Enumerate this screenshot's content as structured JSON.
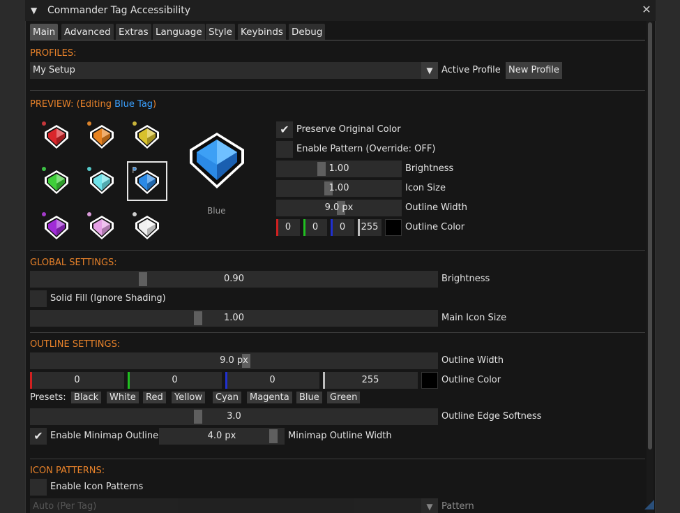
{
  "window": {
    "title": "Commander Tag Accessibility",
    "collapse_glyph": "▼",
    "close_glyph": "✕"
  },
  "tabs": [
    "Main",
    "Advanced",
    "Extras",
    "Language",
    "Style",
    "Keybinds",
    "Debug"
  ],
  "profiles": {
    "header": "PROFILES:",
    "selected": "My Setup",
    "active_label": "Active Profile",
    "new_button": "New Profile"
  },
  "preview": {
    "header_prefix": "PREVIEW: (Editing ",
    "header_tag": "Blue Tag",
    "header_suffix": ")",
    "selected_marker": "P",
    "big_icon_label": "Blue",
    "tags": [
      {
        "name": "red",
        "color": "#d9262b",
        "dot": "#c4363a"
      },
      {
        "name": "orange",
        "color": "#e88320",
        "dot": "#d9822b"
      },
      {
        "name": "yellow",
        "color": "#d8c12c",
        "dot": "#c9b43a"
      },
      {
        "name": "green",
        "color": "#3fcf3a",
        "dot": "#3cbf44"
      },
      {
        "name": "cyan",
        "color": "#6fe3ea",
        "dot": "#55c9c9"
      },
      {
        "name": "blue",
        "color": "#2b8ae6",
        "dot": "#2b8ae6"
      },
      {
        "name": "purple",
        "color": "#a02bd6",
        "dot": "#a33ac9"
      },
      {
        "name": "pink",
        "color": "#e6a0e6",
        "dot": "#d89ad8"
      },
      {
        "name": "white",
        "color": "#f0f0f0",
        "dot": "#d0d0d0"
      }
    ],
    "preserve_color": {
      "label": "Preserve Original Color",
      "checked": true
    },
    "enable_pattern": {
      "label": "Enable Pattern (Override: OFF)",
      "checked": false
    },
    "brightness": {
      "value": "1.00",
      "label": "Brightness",
      "fraction": 0.35
    },
    "icon_size": {
      "value": "1.00",
      "label": "Icon Size",
      "fraction": 0.41
    },
    "outline_width": {
      "value": "9.0 px",
      "label": "Outline Width",
      "fraction": 0.52
    },
    "outline_color": {
      "label": "Outline Color",
      "r": "0",
      "g": "0",
      "b": "0",
      "a": "255"
    }
  },
  "global": {
    "header": "GLOBAL SETTINGS:",
    "brightness": {
      "value": "0.90",
      "label": "Brightness",
      "fraction": 0.27
    },
    "solid_fill": {
      "label": "Solid Fill (Ignore Shading)",
      "checked": false
    },
    "main_icon_size": {
      "value": "1.00",
      "label": "Main Icon Size",
      "fraction": 0.41
    }
  },
  "outline": {
    "header": "OUTLINE SETTINGS:",
    "width": {
      "value": "9.0 px",
      "label": "Outline Width",
      "fraction": 0.53
    },
    "color": {
      "label": "Outline Color",
      "r": "0",
      "g": "0",
      "b": "0",
      "a": "255"
    },
    "presets_label": "Presets:",
    "presets": [
      "Black",
      "White",
      "Red",
      "Yellow",
      "Cyan",
      "Magenta",
      "Blue",
      "Green"
    ],
    "edge_softness": {
      "value": "3.0",
      "label": "Outline Edge Softness",
      "fraction": 0.41
    },
    "minimap": {
      "label": "Enable Minimap Outline",
      "checked": true,
      "value": "4.0 px",
      "width_label": "Minimap Outline Width",
      "fraction": 0.95
    }
  },
  "patterns": {
    "header": "ICON PATTERNS:",
    "enable": {
      "label": "Enable Icon Patterns",
      "checked": false
    },
    "mode": "Auto (Per Tag)",
    "mode_label": "Pattern"
  },
  "colors": {
    "accent": "#e8822a",
    "tag_blue": "#3aa0ff",
    "red_channel": "#d12020",
    "green_channel": "#20c020",
    "blue_channel": "#2030d0",
    "alpha_channel": "#bdbdbd"
  }
}
